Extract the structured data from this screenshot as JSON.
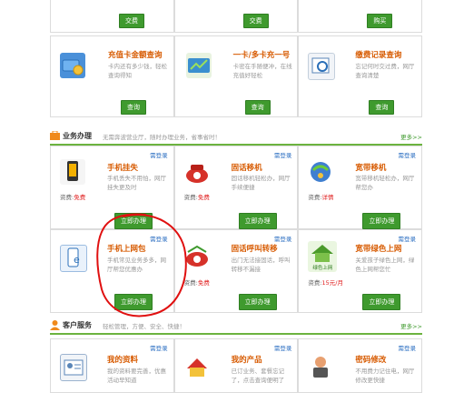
{
  "top_row": {
    "buttons": [
      "交费",
      "交费",
      "购买"
    ]
  },
  "query_row": [
    {
      "title": "充值卡金额查询",
      "desc": "卡内还有多少钱，轻松查询得知",
      "button": "查询",
      "icon": "card-balance-icon"
    },
    {
      "title": "一卡/多卡充一号",
      "desc": "卡密在手随便冲，在线充值好轻松",
      "button": "查询",
      "icon": "multi-card-recharge-icon"
    },
    {
      "title": "缴费记录查询",
      "desc": "忘记何时交过费，网厅查询清楚",
      "button": "查询",
      "icon": "payment-record-icon"
    }
  ],
  "business_section": {
    "title": "业务办理",
    "subtitle": "无需奔波营业厅，随时办理业务，省事省时！",
    "more": "更多>>"
  },
  "business_cards": [
    {
      "title": "手机挂失",
      "desc": "手机丢失不用怕，网厅挂失更及时",
      "fee_label": "资费:",
      "fee_value": "免费",
      "need_login": "需登录",
      "button": "立即办理",
      "icon": "phone-lost-icon"
    },
    {
      "title": "固话移机",
      "desc": "固话移机轻松办，网厅手续便捷",
      "fee_label": "资费:",
      "fee_value": "免费",
      "need_login": "需登录",
      "button": "立即办理",
      "icon": "landline-move-icon"
    },
    {
      "title": "宽带移机",
      "desc": "宽带移机轻松办，网厅帮您办",
      "fee_label": "资费:",
      "fee_value": "详情",
      "need_login": "需登录",
      "button": "立即办理",
      "icon": "broadband-move-icon"
    },
    {
      "title": "手机上网包",
      "desc": "手机常见业务多多，网厅帮您优惠办",
      "fee_label": "",
      "fee_value": "",
      "need_login": "需登录",
      "button": "立即办理",
      "icon": "mobile-data-icon"
    },
    {
      "title": "固话呼叫转移",
      "desc": "出门无法接固话，呼叫转移不漏接",
      "fee_label": "资费:",
      "fee_value": "免费",
      "need_login": "需登录",
      "button": "立即办理",
      "icon": "call-forward-icon"
    },
    {
      "title": "宽带绿色上网",
      "desc": "关爱孩子绿色上网，绿色上网帮您忙",
      "fee_label": "资费:",
      "fee_value": "15元/月",
      "need_login": "需登录",
      "button": "立即办理",
      "icon": "green-internet-icon",
      "icon_text": "绿色上网"
    }
  ],
  "customer_section": {
    "title": "客户服务",
    "subtitle": "轻松管理，方便、安全、快捷！",
    "more": "更多>>"
  },
  "customer_cards": [
    {
      "title": "我的资料",
      "desc": "我的资料要完善，优惠活动早知道",
      "need_login": "需登录",
      "icon": "my-profile-icon"
    },
    {
      "title": "我的产品",
      "desc": "已订业务、套餐忘记了，点击查询便明了",
      "need_login": "需登录",
      "icon": "my-products-icon"
    },
    {
      "title": "密码修改",
      "desc": "不用费力记住电，网厅修改更快捷",
      "need_login": "需登录",
      "icon": "password-change-icon"
    }
  ],
  "colors": {
    "accent_green": "#3f9a2e",
    "title_orange": "#d75a00",
    "free_red": "#e02020",
    "annotation_red": "#e01010"
  }
}
